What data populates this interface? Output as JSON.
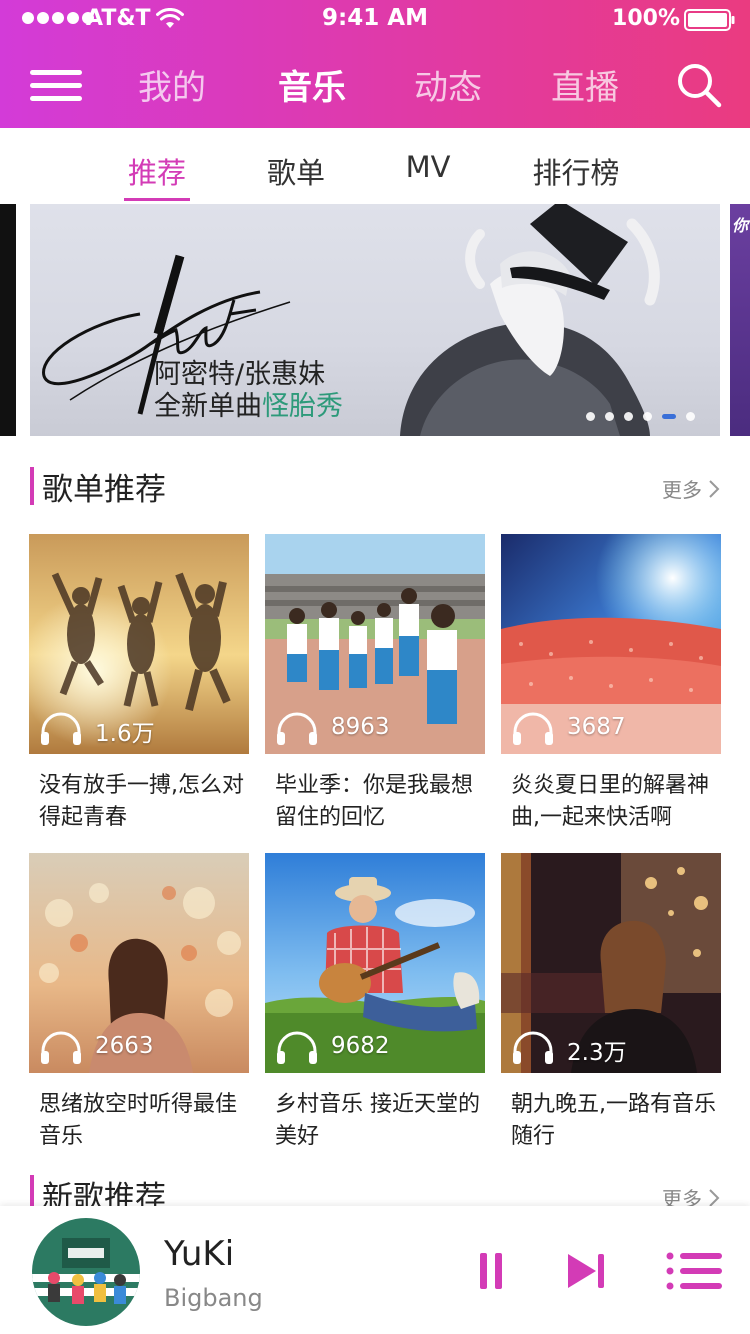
{
  "status_bar": {
    "carrier": "AT&T",
    "time": "9:41 AM",
    "battery": "100%"
  },
  "nav": {
    "tabs": [
      {
        "label": "我的"
      },
      {
        "label": "音乐"
      },
      {
        "label": "动态"
      },
      {
        "label": "直播"
      }
    ],
    "active": "音乐"
  },
  "subtabs": {
    "tabs": [
      {
        "label": "推荐"
      },
      {
        "label": "歌单"
      },
      {
        "label": "MV"
      },
      {
        "label": "排行榜"
      }
    ],
    "active": "推荐"
  },
  "banner": {
    "artist": "阿密特/张惠妹",
    "line2_prefix": "全新单曲",
    "line2_highlight": "怪胎秀",
    "dots_total": 6,
    "active_dot": 5
  },
  "section_playlists": {
    "title": "歌单推荐",
    "more": "更多"
  },
  "playlists": [
    {
      "count": "1.6万",
      "title": "没有放手一搏,怎么对得起青春",
      "scene": "sunset-jump"
    },
    {
      "count": "8963",
      "title": "毕业季：你是我最想留住的回忆",
      "scene": "graduation"
    },
    {
      "count": "3687",
      "title": "炎炎夏日里的解暑神曲,一起来快活啊",
      "scene": "concert"
    },
    {
      "count": "2663",
      "title": "思绪放空时听得最佳音乐",
      "scene": "bokeh-girl"
    },
    {
      "count": "9682",
      "title": "乡村音乐 接近天堂的美好",
      "scene": "guitar-grass"
    },
    {
      "count": "2.3万",
      "title": "朝九晚五,一路有音乐随行",
      "scene": "bus-night"
    }
  ],
  "section_new_songs": {
    "title": "新歌推荐",
    "more": "更多"
  },
  "player": {
    "song": "YuKi",
    "artist": "Bigbang"
  },
  "colors": {
    "accent": "#d33bb6",
    "header_start": "#d33bd8",
    "header_end": "#ea3b80"
  }
}
